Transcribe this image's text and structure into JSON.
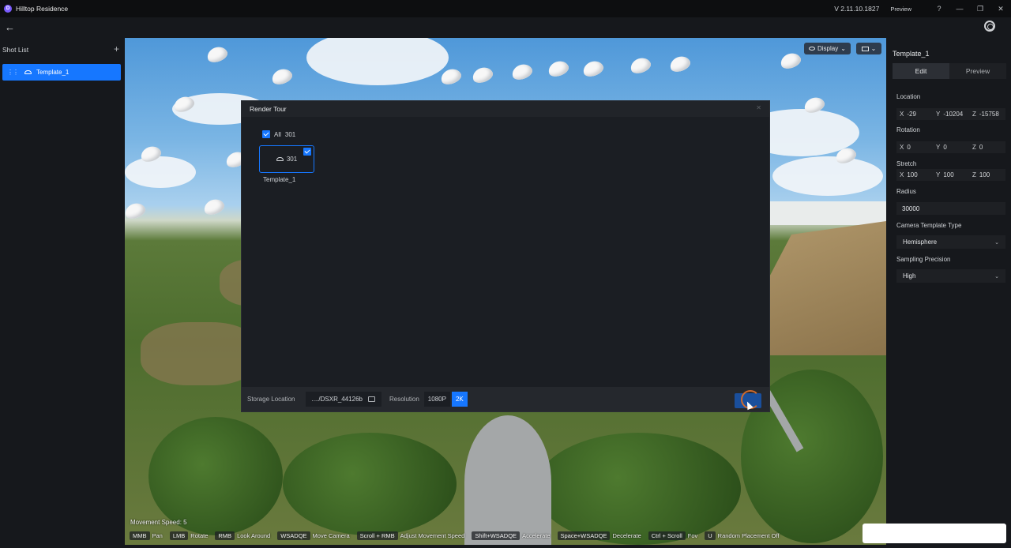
{
  "app": {
    "logo_letter": "D",
    "title": "Hilltop Residence",
    "version": "V 2.11.10.1827",
    "preview_label": "Preview",
    "win_help": "?",
    "win_min": "—",
    "win_restore": "❐",
    "win_close": "✕"
  },
  "toolbar": {
    "back_icon": "←"
  },
  "shot_list": {
    "title": "Shot List",
    "add_icon": "+",
    "items": [
      {
        "label": "Template_1",
        "drag": "⋮⋮"
      }
    ]
  },
  "viewport": {
    "display_label": "Display",
    "display_chevron": "⌄",
    "view_chevron": "⌄",
    "movement_speed": "Movement Speed: 5",
    "shortcuts": [
      {
        "key": "MMB",
        "action": "Pan"
      },
      {
        "key": "LMB",
        "action": "Rotate"
      },
      {
        "key": "RMB",
        "action": "Look Around"
      },
      {
        "key": "WSADQE",
        "action": "Move Camera"
      },
      {
        "key": "Scroll + RMB",
        "action": "Adjust Movement Speed"
      },
      {
        "key": "Shift+WSADQE",
        "action": "Accelerate"
      },
      {
        "key": "Space+WSADQE",
        "action": "Decelerate"
      },
      {
        "key": "Ctrl + Scroll",
        "action": "Fov"
      },
      {
        "key": "U",
        "action": "Random Placement Off"
      }
    ]
  },
  "properties": {
    "title": "Template_1",
    "tabs": [
      {
        "label": "Edit"
      },
      {
        "label": "Preview"
      }
    ],
    "location_label": "Location",
    "location": {
      "x": "-29",
      "y": "-10204",
      "z": "-15758"
    },
    "rotation_label": "Rotation",
    "rotation": {
      "x": "0",
      "y": "0",
      "z": "0"
    },
    "stretch_label": "Stretch",
    "stretch": {
      "x": "100",
      "y": "100",
      "z": "100"
    },
    "radius_label": "Radius",
    "radius": "30000",
    "camera_type_label": "Camera Template Type",
    "camera_type": "Hemisphere",
    "sampling_label": "Sampling Precision",
    "sampling": "High",
    "chevron": "⌄"
  },
  "modal": {
    "title": "Render Tour",
    "close_icon": "✕",
    "all_label": "All",
    "all_count": "301",
    "thumb_count": "301",
    "thumb_label": "Template_1",
    "storage_label": "Storage Location",
    "storage_path": "..../DSXR_44126b",
    "resolution_label": "Resolution",
    "res_options": [
      {
        "label": "1080P"
      },
      {
        "label": "2K"
      }
    ],
    "selected_resolution": "2K"
  }
}
